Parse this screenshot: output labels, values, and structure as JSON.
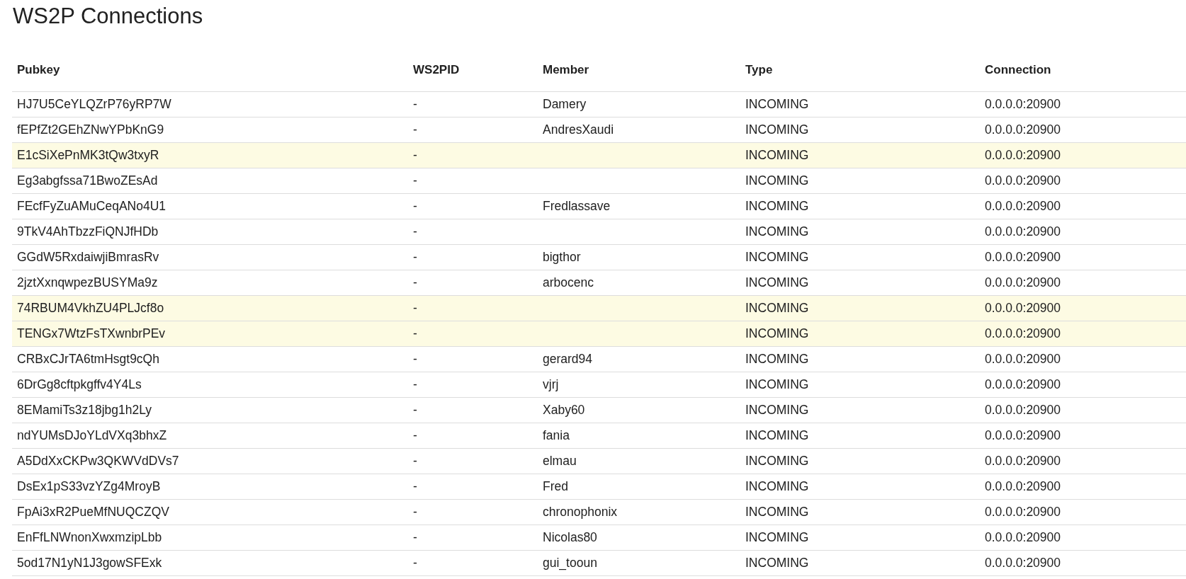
{
  "title": "WS2P Connections",
  "table": {
    "columns": [
      "Pubkey",
      "WS2PID",
      "Member",
      "Type",
      "Connection"
    ],
    "rows": [
      {
        "pubkey": "HJ7U5CeYLQZrP76yRP7W",
        "ws2pid": "-",
        "member": "Damery",
        "type": "INCOMING",
        "connection": "0.0.0.0:20900",
        "highlighted": false
      },
      {
        "pubkey": "fEPfZt2GEhZNwYPbKnG9",
        "ws2pid": "-",
        "member": "AndresXaudi",
        "type": "INCOMING",
        "connection": "0.0.0.0:20900",
        "highlighted": false
      },
      {
        "pubkey": "E1cSiXePnMK3tQw3txyR",
        "ws2pid": "-",
        "type": "INCOMING",
        "connection": "0.0.0.0:20900",
        "highlighted": true
      },
      {
        "pubkey": "Eg3abgfssa71BwoZEsAd",
        "ws2pid": "-",
        "type": "INCOMING",
        "connection": "0.0.0.0:20900",
        "highlighted": false
      },
      {
        "pubkey": "FEcfFyZuAMuCeqANo4U1",
        "ws2pid": "-",
        "member": "Fredlassave",
        "type": "INCOMING",
        "connection": "0.0.0.0:20900",
        "highlighted": false
      },
      {
        "pubkey": "9TkV4AhTbzzFiQNJfHDb",
        "ws2pid": "-",
        "type": "INCOMING",
        "connection": "0.0.0.0:20900",
        "highlighted": false
      },
      {
        "pubkey": "GGdW5RxdaiwjiBmrasRv",
        "ws2pid": "-",
        "member": "bigthor",
        "type": "INCOMING",
        "connection": "0.0.0.0:20900",
        "highlighted": false
      },
      {
        "pubkey": "2jztXxnqwpezBUSYMa9z",
        "ws2pid": "-",
        "member": "arbocenc",
        "type": "INCOMING",
        "connection": "0.0.0.0:20900",
        "highlighted": false
      },
      {
        "pubkey": "74RBUM4VkhZU4PLJcf8o",
        "ws2pid": "-",
        "type": "INCOMING",
        "connection": "0.0.0.0:20900",
        "highlighted": true
      },
      {
        "pubkey": "TENGx7WtzFsTXwnbrPEv",
        "ws2pid": "-",
        "type": "INCOMING",
        "connection": "0.0.0.0:20900",
        "highlighted": true
      },
      {
        "pubkey": "CRBxCJrTA6tmHsgt9cQh",
        "ws2pid": "-",
        "member": "gerard94",
        "type": "INCOMING",
        "connection": "0.0.0.0:20900",
        "highlighted": false
      },
      {
        "pubkey": "6DrGg8cftpkgffv4Y4Ls",
        "ws2pid": "-",
        "member": "vjrj",
        "type": "INCOMING",
        "connection": "0.0.0.0:20900",
        "highlighted": false
      },
      {
        "pubkey": "8EMamiTs3z18jbg1h2Ly",
        "ws2pid": "-",
        "member": "Xaby60",
        "type": "INCOMING",
        "connection": "0.0.0.0:20900",
        "highlighted": false
      },
      {
        "pubkey": "ndYUMsDJoYLdVXq3bhxZ",
        "ws2pid": "-",
        "member": "fania",
        "type": "INCOMING",
        "connection": "0.0.0.0:20900",
        "highlighted": false
      },
      {
        "pubkey": "A5DdXxCKPw3QKWVdDVs7",
        "ws2pid": "-",
        "member": "elmau",
        "type": "INCOMING",
        "connection": "0.0.0.0:20900",
        "highlighted": false
      },
      {
        "pubkey": "DsEx1pS33vzYZg4MroyB",
        "ws2pid": "-",
        "member": "Fred",
        "type": "INCOMING",
        "connection": "0.0.0.0:20900",
        "highlighted": false
      },
      {
        "pubkey": "FpAi3xR2PueMfNUQCZQV",
        "ws2pid": "-",
        "member": "chronophonix",
        "type": "INCOMING",
        "connection": "0.0.0.0:20900",
        "highlighted": false
      },
      {
        "pubkey": "EnFfLNWnonXwxmzipLbb",
        "ws2pid": "-",
        "member": "Nicolas80",
        "type": "INCOMING",
        "connection": "0.0.0.0:20900",
        "highlighted": false
      },
      {
        "pubkey": "5od17N1yN1J3gowSFExk",
        "ws2pid": "-",
        "member": "gui_tooun",
        "type": "INCOMING",
        "connection": "0.0.0.0:20900",
        "highlighted": false
      }
    ]
  }
}
